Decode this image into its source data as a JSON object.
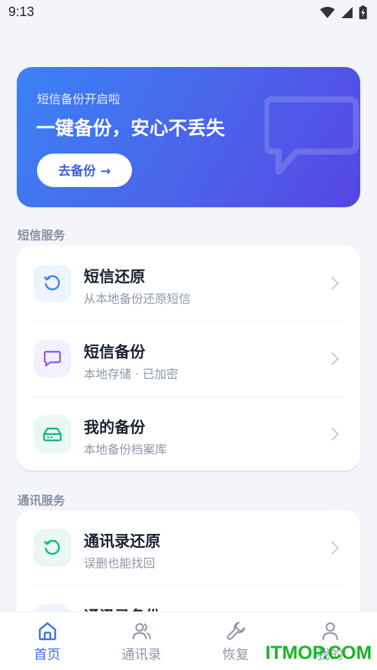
{
  "status": {
    "time": "9:13"
  },
  "banner": {
    "subtitle": "短信备份开启啦",
    "title": "一键备份，安心不丢失",
    "button_label": "去备份 →"
  },
  "sections": [
    {
      "title": "短信服务",
      "items": [
        {
          "title": "短信还原",
          "desc": "从本地备份还原短信",
          "icon": "restore-icon",
          "color": "#3b82f6",
          "bg": "#eef4ff"
        },
        {
          "title": "短信备份",
          "desc": "本地存储 · 已加密",
          "icon": "message-icon",
          "color": "#8b5cf6",
          "bg": "#f4f0ff"
        },
        {
          "title": "我的备份",
          "desc": "本地备份档案库",
          "icon": "drive-icon",
          "color": "#10b981",
          "bg": "#eaf8f1"
        }
      ]
    },
    {
      "title": "通讯服务",
      "items": [
        {
          "title": "通讯录还原",
          "desc": "误删也能找回",
          "icon": "restore-icon",
          "color": "#10b981",
          "bg": "#eaf8f1"
        },
        {
          "title": "通讯录备份",
          "desc": "",
          "icon": "contacts-icon",
          "color": "#3b82f6",
          "bg": "#eef4ff"
        }
      ]
    }
  ],
  "tabs": [
    {
      "label": "首页",
      "icon": "home-icon",
      "active": true
    },
    {
      "label": "通讯录",
      "icon": "contacts-icon",
      "active": false
    },
    {
      "label": "恢复",
      "icon": "wrench-icon",
      "active": false
    },
    {
      "label": "我的",
      "icon": "user-icon",
      "active": false
    }
  ],
  "watermark": "ITMOP.COM"
}
